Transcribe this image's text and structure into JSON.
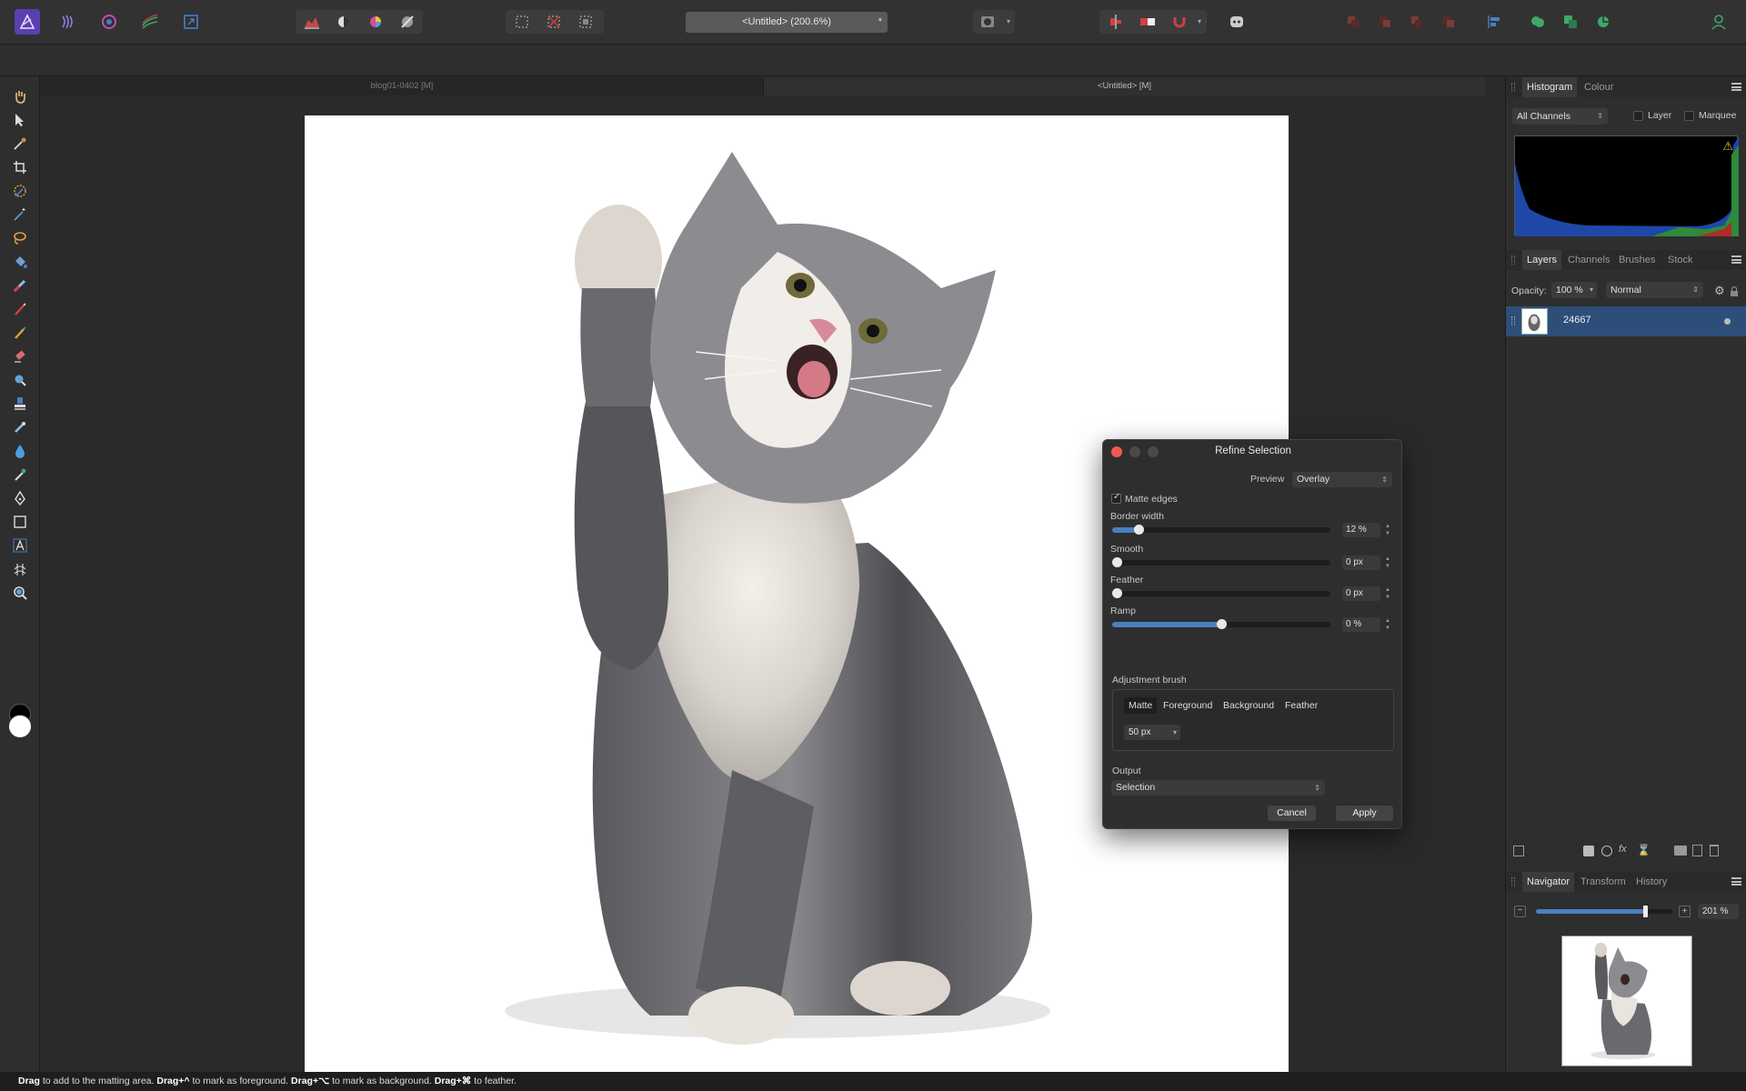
{
  "app": {
    "document_title": "<Untitled> (200.6%)",
    "modified_mark": "*",
    "accent": "#4a7fc1"
  },
  "doc_tabs": [
    "blog01-0402 [M]",
    "<Untitled> [M]"
  ],
  "dialog": {
    "title": "Refine Selection",
    "preview_label": "Preview",
    "preview_value": "Overlay",
    "matte_edges_label": "Matte edges",
    "matte_edges_checked": true,
    "sliders": [
      {
        "label": "Border width",
        "value": "12 %",
        "level": 0.12
      },
      {
        "label": "Smooth",
        "value": "0 px",
        "level": 0
      },
      {
        "label": "Feather",
        "value": "0 px",
        "level": 0
      },
      {
        "label": "Ramp",
        "value": "0 %",
        "level": 0.5
      }
    ],
    "adjustment_brush_label": "Adjustment brush",
    "brush_modes": [
      "Matte",
      "Foreground",
      "Background",
      "Feather"
    ],
    "brush_mode_selected": "Matte",
    "brush_size": "50 px",
    "output_label": "Output",
    "output_value": "Selection",
    "cancel_label": "Cancel",
    "apply_label": "Apply"
  },
  "histogram_panel": {
    "tabs": [
      "Histogram",
      "Colour"
    ],
    "channel_select": "All Channels",
    "layer_label": "Layer",
    "marquee_label": "Marquee"
  },
  "layers_panel": {
    "tabs": [
      "Layers",
      "Channels",
      "Brushes",
      "Stock"
    ],
    "opacity_label": "Opacity:",
    "opacity_value": "100 %",
    "blend_mode": "Normal",
    "layer_name": "24667"
  },
  "navigator_panel": {
    "tabs": [
      "Navigator",
      "Transform",
      "History"
    ],
    "zoom_value": "201 %",
    "zoom_level": 0.8
  },
  "statusbar": {
    "parts": [
      {
        "bold": "Drag",
        "text": " to add to the matting area. "
      },
      {
        "bold": "Drag+^",
        "text": " to mark as foreground. "
      },
      {
        "bold": "Drag+⌥",
        "text": " to mark as background. "
      },
      {
        "bold": "Drag+⌘",
        "text": " to feather."
      }
    ]
  }
}
